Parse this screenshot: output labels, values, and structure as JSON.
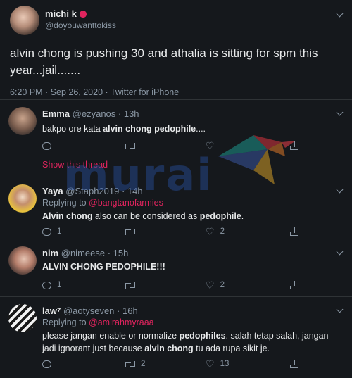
{
  "main_tweet": {
    "name": "michi k",
    "handle": "@doyouwanttokiss",
    "text": "alvin chong is pushing 30 and athalia is sitting for spm this year...jail.......",
    "meta": "6:20 PM · Sep 26, 2020 · Twitter for iPhone"
  },
  "replies": [
    {
      "name": "Emma",
      "handle": "@ezyanos",
      "time": "· 13h",
      "body_plain": "bakpo ore kata ",
      "body_bold": "alvin chong pedophile",
      "body_tail": "....",
      "show_thread": "Show this thread"
    },
    {
      "name": "Yaya",
      "handle": "@Staph2019",
      "time": "· 14h",
      "replying_prefix": "Replying to ",
      "replying_to": "@bangtanofarmies",
      "body_bold1": "Alvin chong",
      "body_mid": " also can be considered as ",
      "body_bold2": "pedophile",
      "body_tail": ".",
      "replies_count": "1",
      "likes_count": "2"
    },
    {
      "name": "nim",
      "handle": "@nimeese",
      "time": "· 15h",
      "body_bold": "ALVIN CHONG PEDOPHILE",
      "body_tail": "!!!",
      "replies_count": "1",
      "likes_count": "2"
    },
    {
      "name": "law⁷",
      "handle": "@aotyseven",
      "time": "· 16h",
      "replying_prefix": "Replying to ",
      "replying_to": "@amirahmyraaa",
      "line1_a": "please jangan enable or normalize ",
      "line1_b": "pedophiles",
      "line1_c": ". salah tetap salah, jangan",
      "line2_a": "jadi ignorant just because ",
      "line2_b": "alvin chong",
      "line2_c": " tu ada rupa sikit je.",
      "retweets_count": "2",
      "likes_count": "13"
    }
  ],
  "watermark": "murai",
  "colors": {
    "background": "#15181c",
    "accent": "#e0245e",
    "muted": "#8b98a5"
  }
}
